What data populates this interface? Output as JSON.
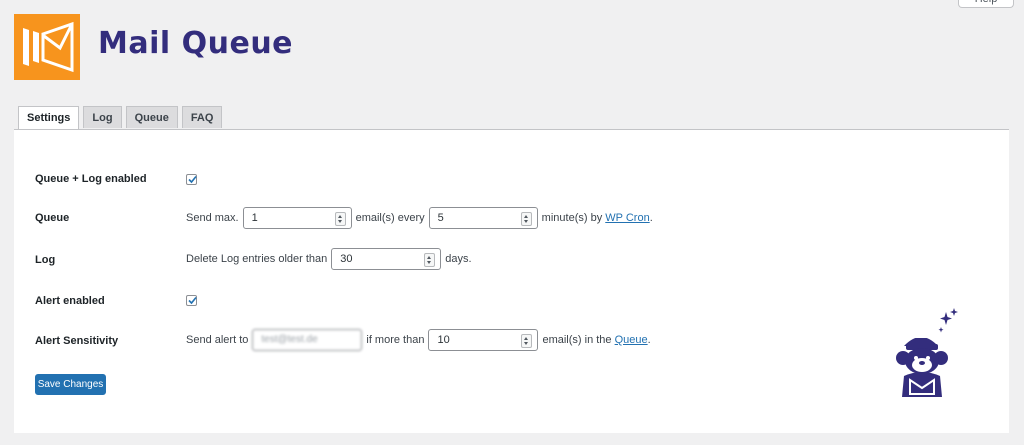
{
  "header": {
    "help_label": "Help",
    "title": "Mail Queue"
  },
  "tabs": [
    {
      "label": "Settings",
      "active": true
    },
    {
      "label": "Log",
      "active": false
    },
    {
      "label": "Queue",
      "active": false
    },
    {
      "label": "FAQ",
      "active": false
    }
  ],
  "settings": {
    "queue_log_enabled": {
      "label": "Queue + Log enabled",
      "checked": true
    },
    "queue": {
      "label": "Queue",
      "prefix": "Send max.",
      "max_value": "1",
      "middle": "email(s) every",
      "interval_value": "5",
      "suffix": "minute(s) by",
      "link_text": "WP Cron",
      "end": "."
    },
    "log": {
      "label": "Log",
      "prefix": "Delete Log entries older than",
      "value": "30",
      "suffix": "days."
    },
    "alert_enabled": {
      "label": "Alert enabled",
      "checked": true
    },
    "alert_sensitivity": {
      "label": "Alert Sensitivity",
      "prefix": "Send alert to",
      "email_value": "test@test.de",
      "middle": "if more than",
      "value": "10",
      "suffix": "email(s) in the",
      "link_text": "Queue",
      "end": "."
    }
  },
  "save_label": "Save Changes",
  "colors": {
    "brand_orange": "#f7941d",
    "brand_purple": "#332d7d",
    "primary_button": "#2271b1",
    "link": "#2271b1"
  }
}
